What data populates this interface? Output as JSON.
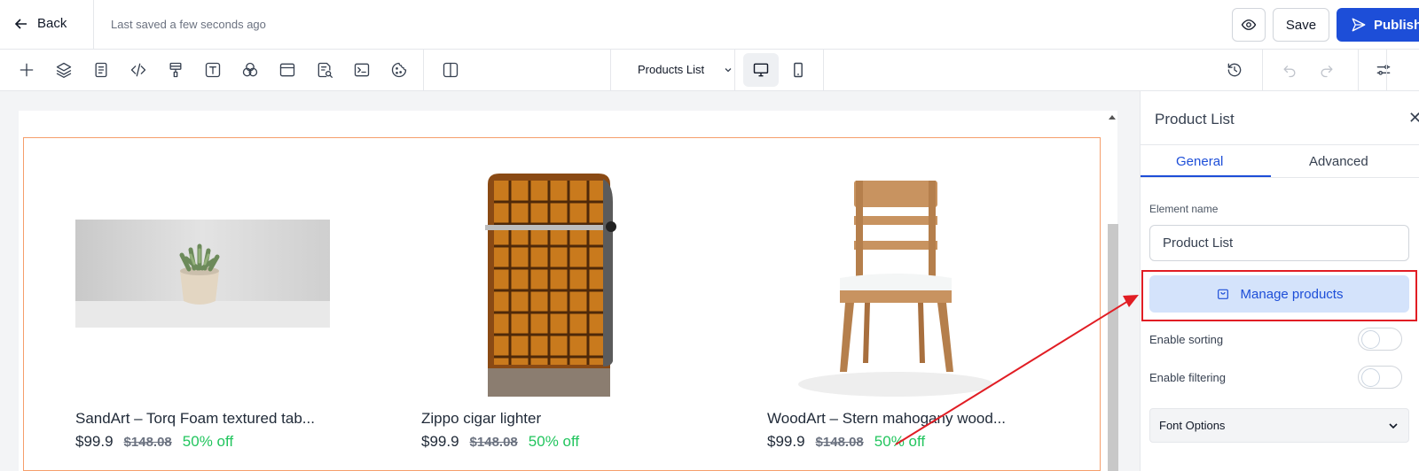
{
  "header": {
    "back_label": "Back",
    "saved_status": "Last saved a few seconds ago",
    "save_label": "Save",
    "publish_label": "Publish"
  },
  "toolbar": {
    "icons": [
      "plus-icon",
      "layers-icon",
      "pages-icon",
      "code-icon",
      "paint-roller-icon",
      "text-icon",
      "shapes-icon",
      "layout-icon",
      "search-doc-icon",
      "terminal-icon",
      "cookie-icon",
      "split-view-icon"
    ],
    "page_select_label": "Products List",
    "devices": [
      "desktop-icon",
      "mobile-icon"
    ],
    "right_icons": [
      "history-icon",
      "undo-icon",
      "redo-icon",
      "settings-icon"
    ]
  },
  "products": [
    {
      "title": "SandArt – Torq Foam textured tab...",
      "price": "$99.9",
      "old_price": "$148.08",
      "discount": "50% off",
      "image": "plant-pot"
    },
    {
      "title": "Zippo cigar lighter",
      "price": "$99.9",
      "old_price": "$148.08",
      "discount": "50% off",
      "image": "lighter"
    },
    {
      "title": "WoodArt – Stern mahogany wood...",
      "price": "$99.9",
      "old_price": "$148.08",
      "discount": "50% off",
      "image": "wooden-chair"
    }
  ],
  "panel": {
    "title": "Product List",
    "tabs": [
      "General",
      "Advanced"
    ],
    "active_tab": "General",
    "element_name_label": "Element name",
    "element_name_value": "Product List",
    "manage_products_label": "Manage products",
    "enable_sorting_label": "Enable sorting",
    "enable_sorting": false,
    "enable_filtering_label": "Enable filtering",
    "enable_filtering": false,
    "font_options_label": "Font Options"
  },
  "colors": {
    "accent": "#1d4ed8",
    "selection_border": "#f59e6b",
    "annotation": "#e11d24",
    "discount": "#22c55e"
  }
}
